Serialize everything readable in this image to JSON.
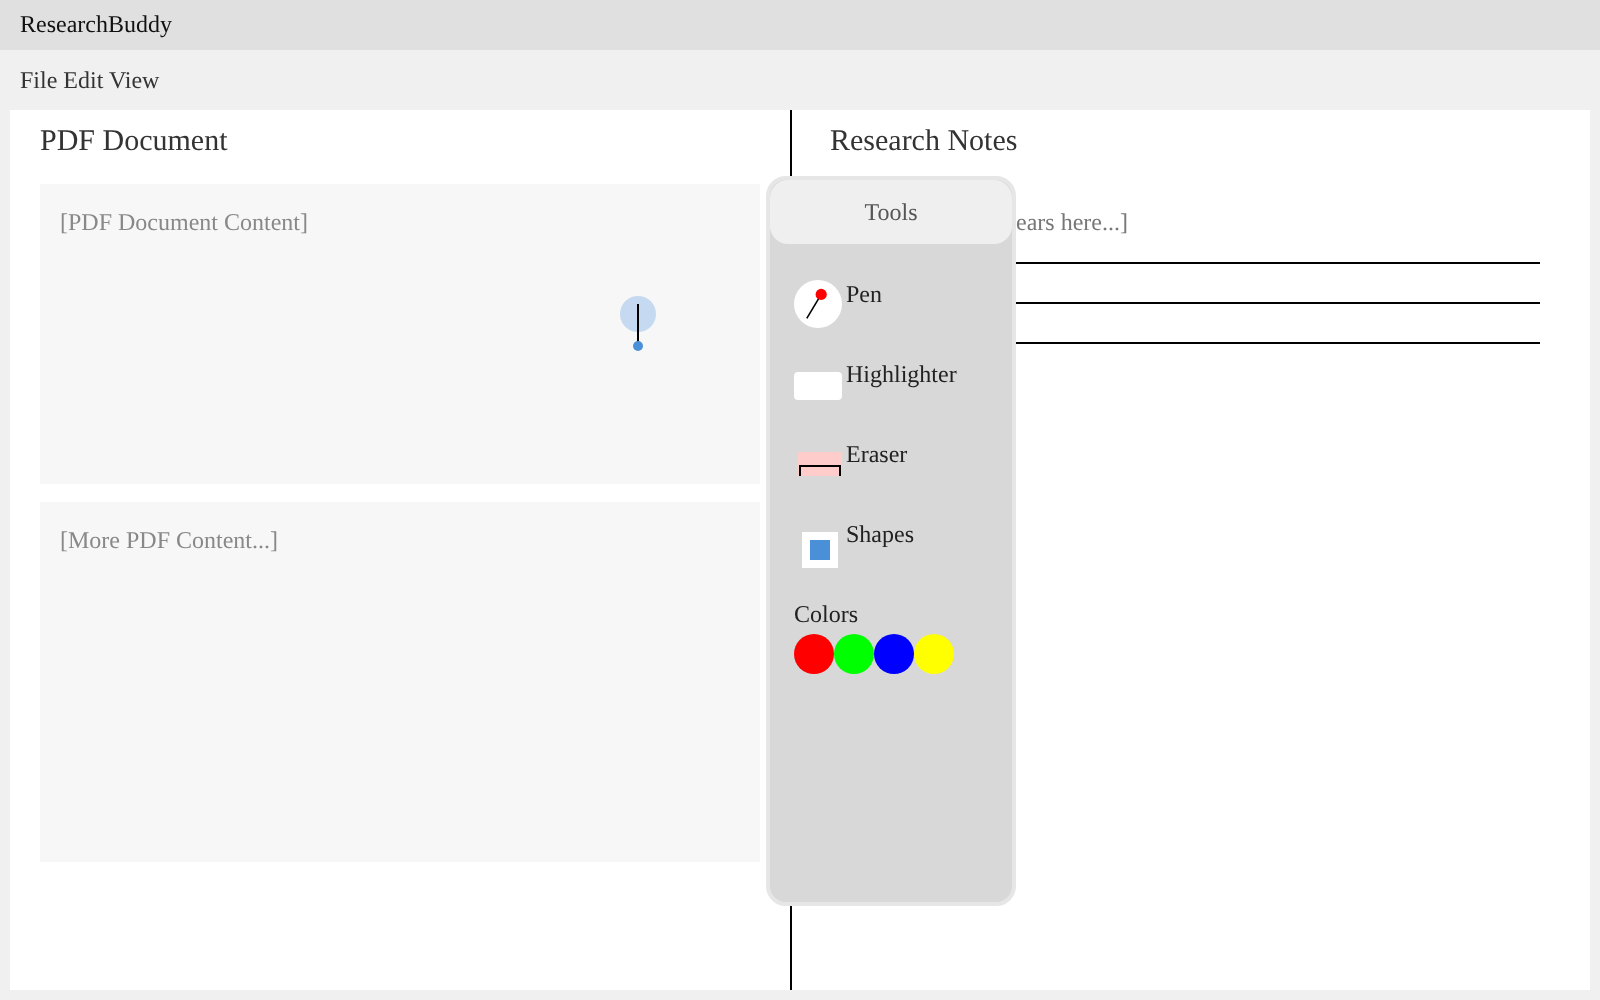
{
  "window": {
    "title": "ResearchBuddy"
  },
  "menu": [
    "File Edit View"
  ],
  "pdf_panel": {
    "title": "PDF Document",
    "blocks": [
      "[PDF Document Content]",
      "[More PDF Content...]"
    ]
  },
  "notes_panel": {
    "title": "Research Notes",
    "placeholder": "ears here...]"
  },
  "tools": {
    "title": "Tools",
    "items": [
      {
        "kind": "pen",
        "label": "Pen"
      },
      {
        "kind": "highlighter",
        "label": "Highlighter"
      },
      {
        "kind": "eraser",
        "label": "Eraser"
      },
      {
        "kind": "shapes",
        "label": "Shapes"
      },
      {
        "kind": "colors",
        "label": "Colors",
        "swatches": [
          {
            "color": "#ff0000"
          },
          {
            "color": "#00ff00"
          },
          {
            "color": "#0000ff"
          },
          {
            "color": "#ffff00"
          }
        ]
      }
    ]
  }
}
